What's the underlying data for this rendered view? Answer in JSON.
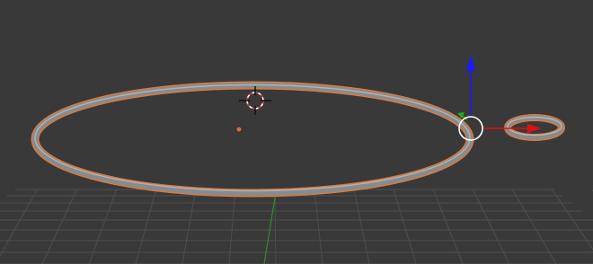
{
  "viewport": {
    "view": "3D Viewport",
    "colors": {
      "background": "#393939",
      "grid": "#4e4e4e",
      "y_axis": "#2f8a2f",
      "selection_outline": "#e07a3a",
      "torus_body": "#8a8a8a",
      "torus_highlight": "#b5b5b5",
      "gizmo_z": "#1a1aff",
      "gizmo_x": "#e01010",
      "gizmo_y": "#20b020",
      "gizmo_center": "#ffffff",
      "cursor_ring_a": "#ffffff",
      "cursor_ring_b": "#c03030",
      "cursor_cross": "#111111",
      "origin_dot": "#d07040"
    },
    "objects": [
      {
        "name": "large-torus",
        "selected": true,
        "kind": "torus"
      },
      {
        "name": "small-torus",
        "selected": true,
        "active": true,
        "kind": "torus"
      }
    ],
    "gizmo": {
      "type": "translate",
      "axes": [
        "x",
        "y",
        "z"
      ]
    },
    "cursor_3d": {
      "icon": "crosshair-icon"
    }
  }
}
